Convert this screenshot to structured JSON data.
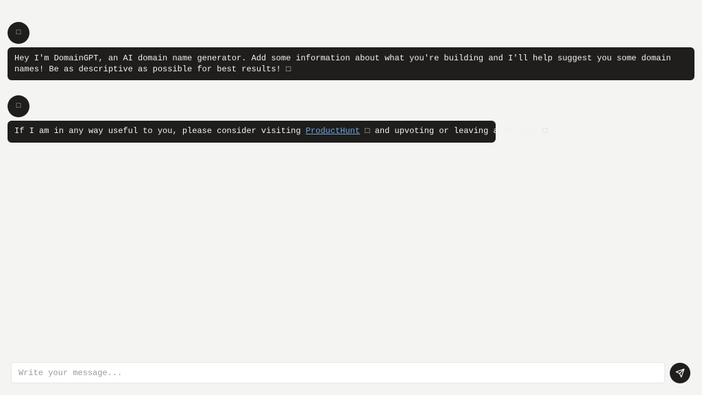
{
  "messages": [
    {
      "avatar_glyph": "□",
      "text": "Hey I'm DomainGPT, an AI domain name generator. Add some information about what you're building and I'll help suggest you some domain names! Be as descriptive as possible for best results!",
      "trailing_glyph": "□"
    },
    {
      "avatar_glyph": "□",
      "text_before_link": "If I am in any way useful to you, please consider visiting ",
      "link_text": "ProductHunt",
      "link_glyph": "□",
      "text_after_link": " and upvoting or leaving a review! ",
      "trailing_glyph": "□"
    }
  ],
  "composer": {
    "placeholder": "Write your message...",
    "value": ""
  },
  "send_button": {
    "icon": "paper-plane-icon"
  },
  "colors": {
    "background": "#f4f4f3",
    "bubble": "#1f1e1c",
    "link": "#6ea3e0"
  }
}
